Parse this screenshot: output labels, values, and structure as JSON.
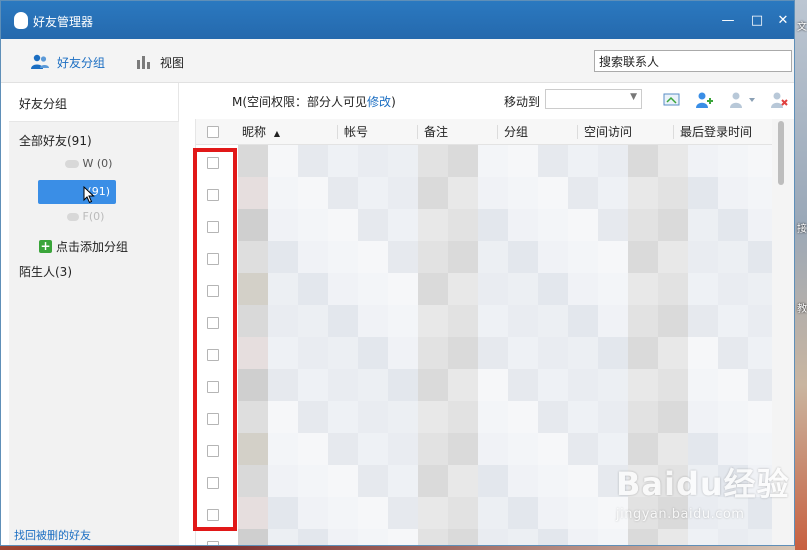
{
  "window": {
    "title": "好友管理器"
  },
  "toolbar": {
    "tabs": [
      {
        "label": "好友分组",
        "active": true,
        "icon": "friends-icon"
      },
      {
        "label": "视图",
        "active": false,
        "icon": "chart-view-icon"
      }
    ],
    "search": {
      "placeholder": "搜索联系人",
      "value": "搜索联系人"
    }
  },
  "sidebar": {
    "header": "好友分组",
    "all_friends": "全部好友(91)",
    "groups": [
      {
        "label": "W (0)"
      },
      {
        "label": "(91)",
        "selected": true
      },
      {
        "label": "F(0)"
      }
    ],
    "add_group": "点击添加分组",
    "strangers": "陌生人(3)",
    "restore_link": "找回被删的好友"
  },
  "main": {
    "permission": {
      "prefix": "M(空间权限：部分人可见",
      "link": "修改",
      "suffix": ")"
    },
    "move_to_label": "移动到",
    "move_to_value": "",
    "columns": [
      "昵称",
      "帐号",
      "备注",
      "分组",
      "空间访问",
      "最后登录时间"
    ],
    "sort_column": "昵称",
    "row_count": 13
  },
  "watermark": {
    "main": "Baidu经验",
    "sub": "jingyan.baidu.com"
  },
  "colors": {
    "titlebar": "#2b79c0",
    "accent": "#1b6ec2",
    "selection": "#3a8ee6",
    "highlight": "#e11818"
  }
}
